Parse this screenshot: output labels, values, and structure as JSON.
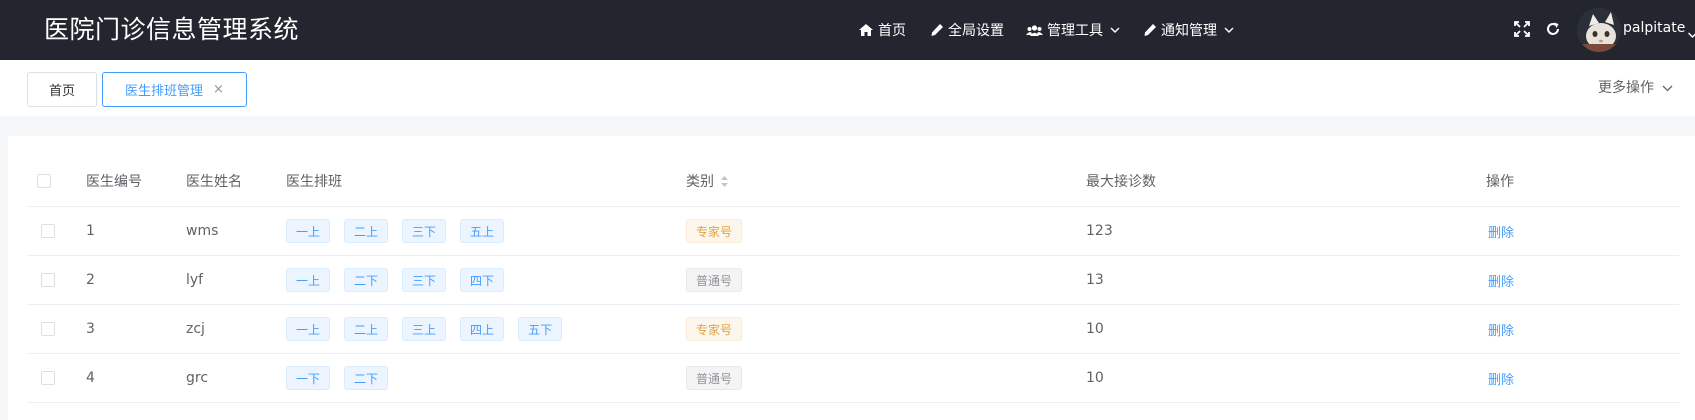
{
  "app": {
    "title": "医院门诊信息管理系统"
  },
  "nav": {
    "items": [
      {
        "label": "首页",
        "icon": "home-icon"
      },
      {
        "label": "全局设置",
        "icon": "pencil-icon"
      },
      {
        "label": "管理工具",
        "icon": "users-icon",
        "dropdown": true
      },
      {
        "label": "通知管理",
        "icon": "pencil-icon",
        "dropdown": true
      }
    ],
    "user": {
      "name": "palpitate"
    }
  },
  "tabs": {
    "items": [
      {
        "label": "首页",
        "active": false
      },
      {
        "label": "医生排班管理",
        "active": true,
        "close": "×"
      }
    ],
    "more_label": "更多操作"
  },
  "table": {
    "columns": [
      "医生编号",
      "医生姓名",
      "医生排班",
      "类别",
      "最大接诊数",
      "操作"
    ],
    "rows": [
      {
        "id": "1",
        "name": "wms",
        "shifts": [
          "一上",
          "二上",
          "三下",
          "五上"
        ],
        "category": "专家号",
        "category_type": "warn",
        "max": "123",
        "action": "删除"
      },
      {
        "id": "2",
        "name": "lyf",
        "shifts": [
          "一上",
          "二下",
          "三下",
          "四下"
        ],
        "category": "普通号",
        "category_type": "info",
        "max": "13",
        "action": "删除"
      },
      {
        "id": "3",
        "name": "zcj",
        "shifts": [
          "一上",
          "二上",
          "三上",
          "四上",
          "五下"
        ],
        "category": "专家号",
        "category_type": "warn",
        "max": "10",
        "action": "删除"
      },
      {
        "id": "4",
        "name": "grc",
        "shifts": [
          "一下",
          "二下"
        ],
        "category": "普通号",
        "category_type": "info",
        "max": "10",
        "action": "删除"
      }
    ]
  },
  "colors": {
    "navbar_bg": "#23262e",
    "accent": "#409eff",
    "warning": "#e6a23c",
    "info": "#909399"
  }
}
